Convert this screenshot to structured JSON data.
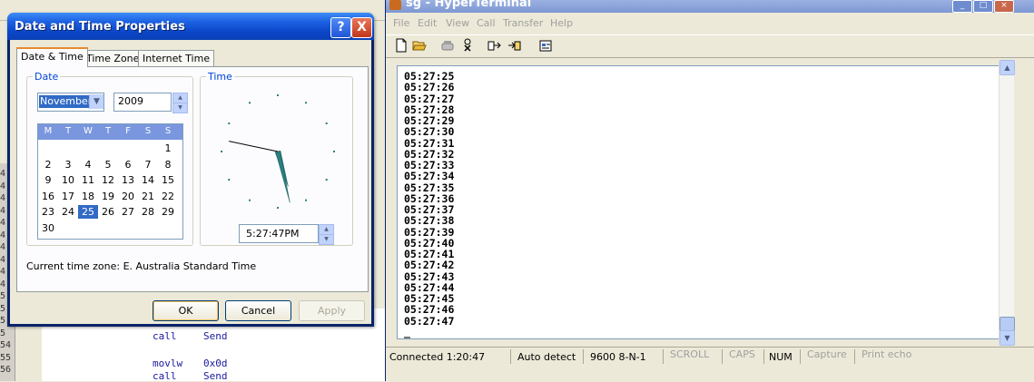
{
  "background": {
    "gutter_numbers": [
      "4",
      "4",
      "4",
      "4",
      "4",
      "4",
      "4",
      "4",
      "4",
      "4",
      "5",
      "5",
      "5",
      "5",
      "54",
      "55",
      "56"
    ],
    "code_lines": [
      {
        "op": "call",
        "arg": "Send"
      },
      {
        "op": "movlw",
        "arg": "0x0d"
      },
      {
        "op": "call",
        "arg": "Send"
      }
    ]
  },
  "dialog": {
    "title": "Date and Time Properties",
    "help_button": "?",
    "close_button": "X",
    "tabs": [
      {
        "label": "Date & Time"
      },
      {
        "label": "Time Zone"
      },
      {
        "label": "Internet Time"
      }
    ],
    "date": {
      "group_label": "Date",
      "month": "November",
      "year": "2009",
      "weekdays": [
        "M",
        "T",
        "W",
        "T",
        "F",
        "S",
        "S"
      ],
      "weeks": [
        [
          "",
          "",
          "",
          "",
          "",
          "",
          "1"
        ],
        [
          "2",
          "3",
          "4",
          "5",
          "6",
          "7",
          "8"
        ],
        [
          "9",
          "10",
          "11",
          "12",
          "13",
          "14",
          "15"
        ],
        [
          "16",
          "17",
          "18",
          "19",
          "20",
          "21",
          "22"
        ],
        [
          "23",
          "24",
          "25",
          "26",
          "27",
          "28",
          "29"
        ],
        [
          "30",
          "",
          "",
          "",
          "",
          "",
          ""
        ]
      ],
      "selected_day": "25"
    },
    "time": {
      "group_label": "Time",
      "value": "5:27:47PM",
      "clock": {
        "hour": 5,
        "minute": 27,
        "second": 47
      }
    },
    "timezone_text": "Current time zone:  E. Australia Standard Time",
    "buttons": {
      "ok": "OK",
      "cancel": "Cancel",
      "apply": "Apply"
    }
  },
  "hyperterminal": {
    "title": "sg - HyperTerminal",
    "menu": [
      "File",
      "Edit",
      "View",
      "Call",
      "Transfer",
      "Help"
    ],
    "lines": [
      "05:27:25",
      "05:27:26",
      "05:27:27",
      "05:27:28",
      "05:27:29",
      "05:27:30",
      "05:27:31",
      "05:27:32",
      "05:27:33",
      "05:27:34",
      "05:27:35",
      "05:27:36",
      "05:27:37",
      "05:27:38",
      "05:27:39",
      "05:27:40",
      "05:27:41",
      "05:27:42",
      "05:27:43",
      "05:27:44",
      "05:27:45",
      "05:27:46",
      "05:27:47",
      "_"
    ],
    "status": {
      "connected": "Connected 1:20:47",
      "detect": "Auto detect",
      "settings": "9600 8-N-1",
      "scroll": "SCROLL",
      "caps": "CAPS",
      "num": "NUM",
      "capture": "Capture",
      "print_echo": "Print echo"
    }
  },
  "colors": {
    "xp_title": "#0b46c8",
    "selection": "#316ac5",
    "calendar_header": "#7a96df",
    "clock_hands": "#2a8080"
  }
}
